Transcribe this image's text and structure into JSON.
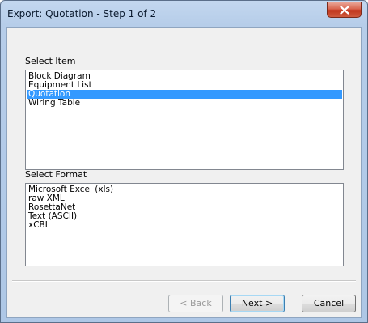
{
  "window": {
    "title": "Export: Quotation - Step 1 of 2"
  },
  "select_item": {
    "label": "Select Item",
    "items": [
      "Block Diagram",
      "Equipment List",
      "Quotation",
      "Wiring Table"
    ],
    "selected": "Quotation"
  },
  "select_format": {
    "label": "Select Format",
    "items": [
      "Microsoft Excel (xls)",
      "raw XML",
      "RosettaNet",
      "Text (ASCII)",
      "xCBL"
    ]
  },
  "buttons": {
    "back": "< Back",
    "next": "Next >",
    "cancel": "Cancel"
  },
  "colors": {
    "selection": "#3399ff",
    "close_button": "#c0361c"
  },
  "icons": {
    "close": "close-icon"
  }
}
